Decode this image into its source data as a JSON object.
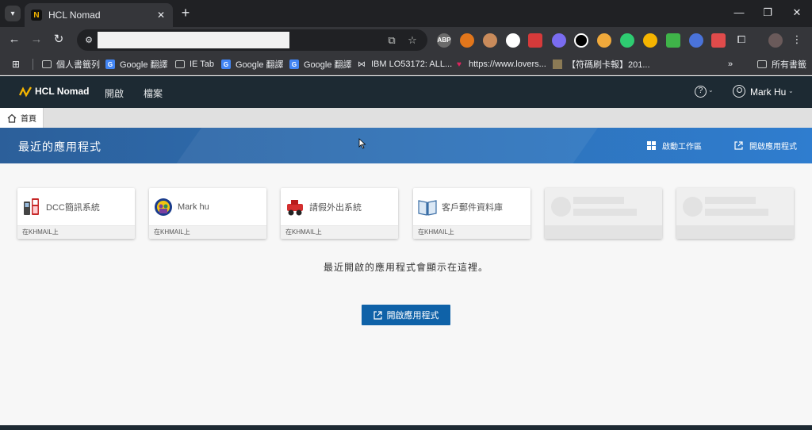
{
  "browser": {
    "tab_title": "HCL Nomad",
    "bookmarks": [
      {
        "label": "個人書籤列",
        "icon": "folder-icon"
      },
      {
        "label": "Google 翻譯",
        "icon": "google-translate-icon"
      },
      {
        "label": "IE Tab",
        "icon": "folder-icon"
      },
      {
        "label": "Google 翻譯",
        "icon": "google-translate-icon"
      },
      {
        "label": "Google 翻譯",
        "icon": "google-translate-icon"
      },
      {
        "label": "IBM LO53172: ALL...",
        "icon": "ibm-icon"
      },
      {
        "label": "https://www.lovers...",
        "icon": "heart-icon"
      },
      {
        "label": "【符碼刷卡報】201...",
        "icon": "image-icon"
      }
    ],
    "bookmarks_overflow": "»",
    "all_bookmarks": "所有書籤",
    "extension_labels": [
      "ABP"
    ]
  },
  "app": {
    "brand": "HCL Nomad",
    "menu": [
      "開啟",
      "檔案"
    ],
    "user_name": "Mark Hu",
    "home_tab": "首頁",
    "banner": {
      "title": "最近的應用程式",
      "launch_workspace": "啟動工作區",
      "open_app": "開啟應用程式"
    },
    "cards": [
      {
        "name": "DCC簡訊系統",
        "server": "在KHMAIL上",
        "icon": "phone-icon"
      },
      {
        "name": "Mark hu",
        "server": "在KHMAIL上",
        "icon": "mail-globe-icon"
      },
      {
        "name": "請假外出系統",
        "server": "在KHMAIL上",
        "icon": "vehicle-icon"
      },
      {
        "name": "客戶郵件資料庫",
        "server": "在KHMAIL上",
        "icon": "book-icon"
      }
    ],
    "empty_message": "最近開啟的應用程式會顯示在這裡。",
    "open_button": "開啟應用程式"
  },
  "colors": {
    "appbar": "#1d2a33",
    "banner": "#2e6fb3",
    "primary_button": "#0f62a8"
  }
}
